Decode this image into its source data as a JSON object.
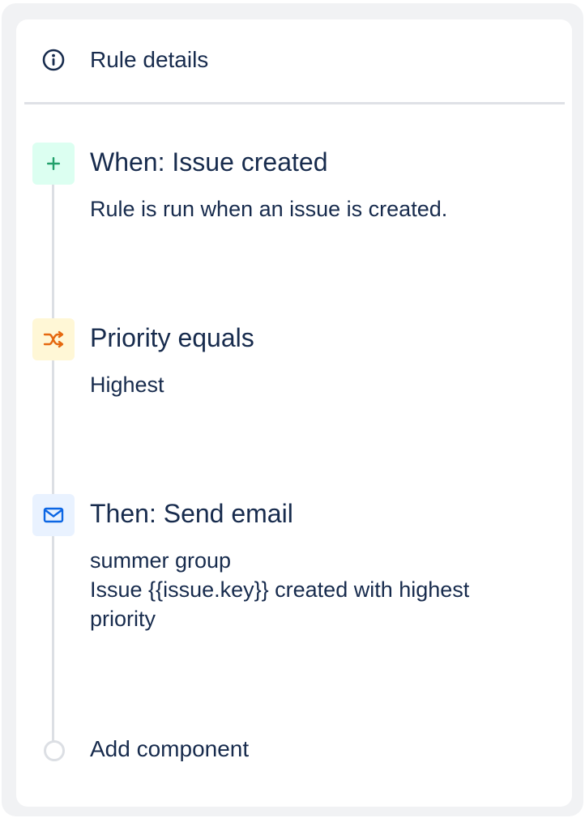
{
  "rule_details": {
    "label": "Rule details",
    "icon": "info-icon"
  },
  "steps": [
    {
      "title": "When: Issue created",
      "description": [
        "Rule is run when an issue is created."
      ],
      "icon": "plus-icon",
      "icon_color": "#22a06b",
      "icon_bg": "#dcfff1"
    },
    {
      "title": "Priority equals",
      "description": [
        "Highest"
      ],
      "icon": "shuffle-icon",
      "icon_color": "#e56910",
      "icon_bg": "#fff7d6"
    },
    {
      "title": "Then: Send email",
      "description": [
        "summer group",
        "Issue {{issue.key}} created with highest",
        "priority"
      ],
      "icon": "mail-icon",
      "icon_color": "#0c66e4",
      "icon_bg": "#e9f2ff"
    }
  ],
  "add_component": {
    "label": "Add component"
  },
  "colors": {
    "text": "#172b4d",
    "timeline": "#dcdfe4",
    "background": "#f1f2f4"
  }
}
